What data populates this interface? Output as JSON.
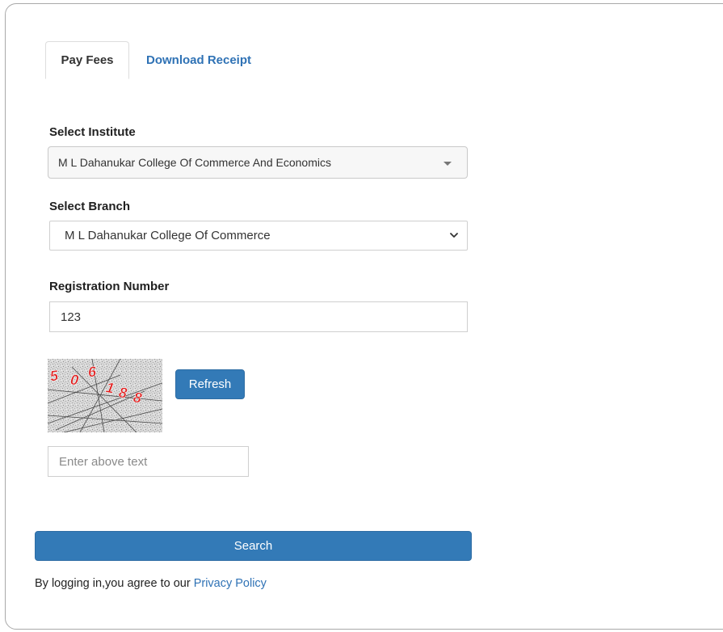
{
  "tabs": [
    {
      "label": "Pay Fees",
      "active": true
    },
    {
      "label": "Download Receipt",
      "active": false
    }
  ],
  "institute": {
    "label": "Select Institute",
    "selected": "M L Dahanukar College Of Commerce And Economics"
  },
  "branch": {
    "label": "Select Branch",
    "selected": "M L Dahanukar College Of Commerce"
  },
  "registration": {
    "label": "Registration Number",
    "value": "123"
  },
  "captcha": {
    "code": "506188",
    "refresh_label": "Refresh",
    "input_placeholder": "Enter above text"
  },
  "search_label": "Search",
  "footer": {
    "prefix": "By logging in,you agree to our",
    "link": "Privacy Policy"
  },
  "colors": {
    "primary": "#337ab7",
    "link": "#2f72b5",
    "captcha_digits": "#e01b1b"
  }
}
